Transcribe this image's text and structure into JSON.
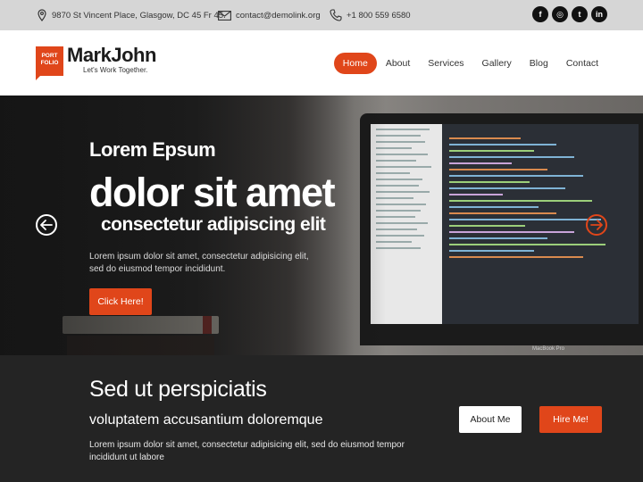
{
  "topbar": {
    "address": "9870 St Vincent Place, Glasgow, DC 45 Fr 45.",
    "email": "contact@demolink.org",
    "phone": "+1 800 559 6580",
    "socials": [
      {
        "icon": "facebook-icon",
        "glyph": "f"
      },
      {
        "icon": "instagram-icon",
        "glyph": "◎"
      },
      {
        "icon": "twitter-icon",
        "glyph": "t"
      },
      {
        "icon": "linkedin-icon",
        "glyph": "in"
      }
    ]
  },
  "header": {
    "logo_badge_line1": "PORT",
    "logo_badge_line2": "FOLIO",
    "logo_name": "MarkJohn",
    "logo_tagline": "Let's Work Together.",
    "nav": [
      "Home",
      "About",
      "Services",
      "Gallery",
      "Blog",
      "Contact"
    ],
    "active_nav": "Home"
  },
  "hero": {
    "subtitle": "Lorem Epsum",
    "title": "dolor sit amet",
    "title2": "consectetur adipiscing elit",
    "text": "Lorem ipsum dolor sit amet, consectetur adipisicing elit, sed do eiusmod tempor incididunt.",
    "button": "Click Here!",
    "laptop_label": "MacBook Pro"
  },
  "cta": {
    "title": "Sed ut perspiciatis",
    "subtitle": "voluptatem accusantium doloremque",
    "text": "Lorem ipsum dolor sit amet, consectetur adipisicing elit, sed do eiusmod tempor incididunt ut labore",
    "about_button": "About Me",
    "hire_button": "Hire Me!"
  },
  "colors": {
    "accent": "#e0461a",
    "topbar_bg": "#d6d6d6",
    "dark_bg": "#242424"
  }
}
